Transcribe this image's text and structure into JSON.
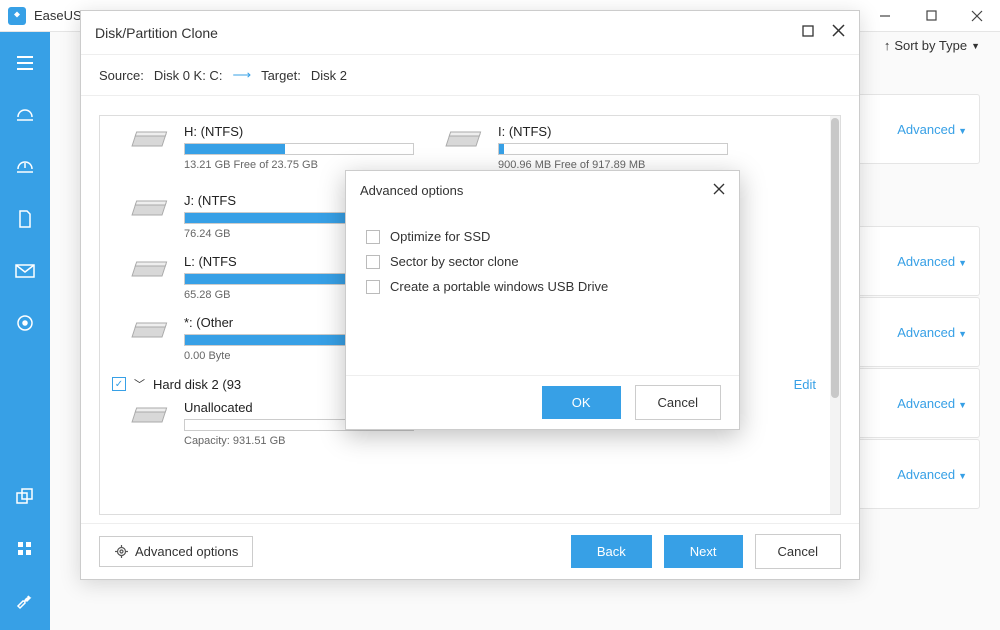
{
  "app": {
    "title": "EaseUS Todo Backup"
  },
  "sort": {
    "label": "Sort by Type"
  },
  "cards": {
    "advanced": "Advanced"
  },
  "dialog": {
    "title": "Disk/Partition Clone",
    "source_label": "Source:",
    "source_value": "Disk 0 K: C:",
    "target_label": "Target:",
    "target_value": "Disk 2",
    "partitions": [
      {
        "name": "H: (NTFS)",
        "sub": "13.21 GB Free of 23.75 GB",
        "fill": 44
      },
      {
        "name": "I: (NTFS)",
        "sub": "900.96 MB Free of 917.89 MB",
        "fill": 2
      },
      {
        "name": "J: (NTFS",
        "sub": "76.24 GB",
        "fill": 100
      },
      {
        "name": "L: (NTFS",
        "sub": "65.28 GB",
        "fill": 100
      },
      {
        "name": "*: (Other",
        "sub": "0.00 Byte",
        "fill": 100
      }
    ],
    "disk_row": {
      "label": "Hard disk 2 (93",
      "edit": "Edit"
    },
    "unalloc": {
      "name": "Unallocated",
      "sub": "Capacity: 931.51 GB"
    },
    "footer": {
      "advanced": "Advanced options",
      "back": "Back",
      "next": "Next",
      "cancel": "Cancel"
    }
  },
  "modal": {
    "title": "Advanced options",
    "options": [
      "Optimize for SSD",
      "Sector by sector clone",
      "Create a portable windows USB Drive"
    ],
    "ok": "OK",
    "cancel": "Cancel"
  }
}
